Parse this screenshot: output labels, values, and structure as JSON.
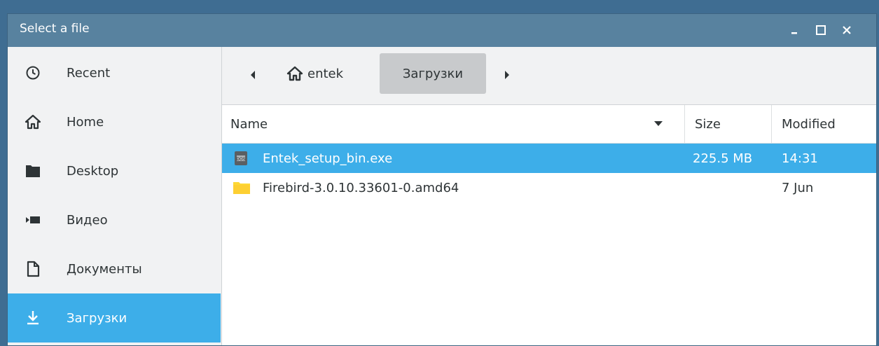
{
  "window": {
    "title": "Select a file",
    "minimize_glyph": "_",
    "maximize_glyph": "□",
    "close_glyph": "×"
  },
  "sidebar": {
    "items": [
      {
        "label": "Recent",
        "icon": "clock-icon"
      },
      {
        "label": "Home",
        "icon": "home-icon"
      },
      {
        "label": "Desktop",
        "icon": "folder-icon"
      },
      {
        "label": "Видео",
        "icon": "video-icon"
      },
      {
        "label": "Документы",
        "icon": "document-icon"
      },
      {
        "label": "Загрузки",
        "icon": "download-icon",
        "selected": true
      }
    ]
  },
  "pathbar": {
    "crumbs": [
      {
        "label": "entek",
        "icon": "home-icon"
      },
      {
        "label": "Загрузки",
        "active": true
      }
    ]
  },
  "table": {
    "columns": {
      "name": "Name",
      "size": "Size",
      "modified": "Modified"
    },
    "rows": [
      {
        "name": "Entek_setup_bin.exe",
        "size": "225.5 MB",
        "modified": "14:31",
        "icon": "executable-file-icon",
        "selected": true
      },
      {
        "name": "Firebird-3.0.10.33601-0.amd64",
        "size": "",
        "modified": "7 Jun",
        "icon": "folder-icon"
      }
    ]
  },
  "colors": {
    "titlebar": "#58829f",
    "selection": "#3daee9",
    "folder": "#fdd835"
  }
}
